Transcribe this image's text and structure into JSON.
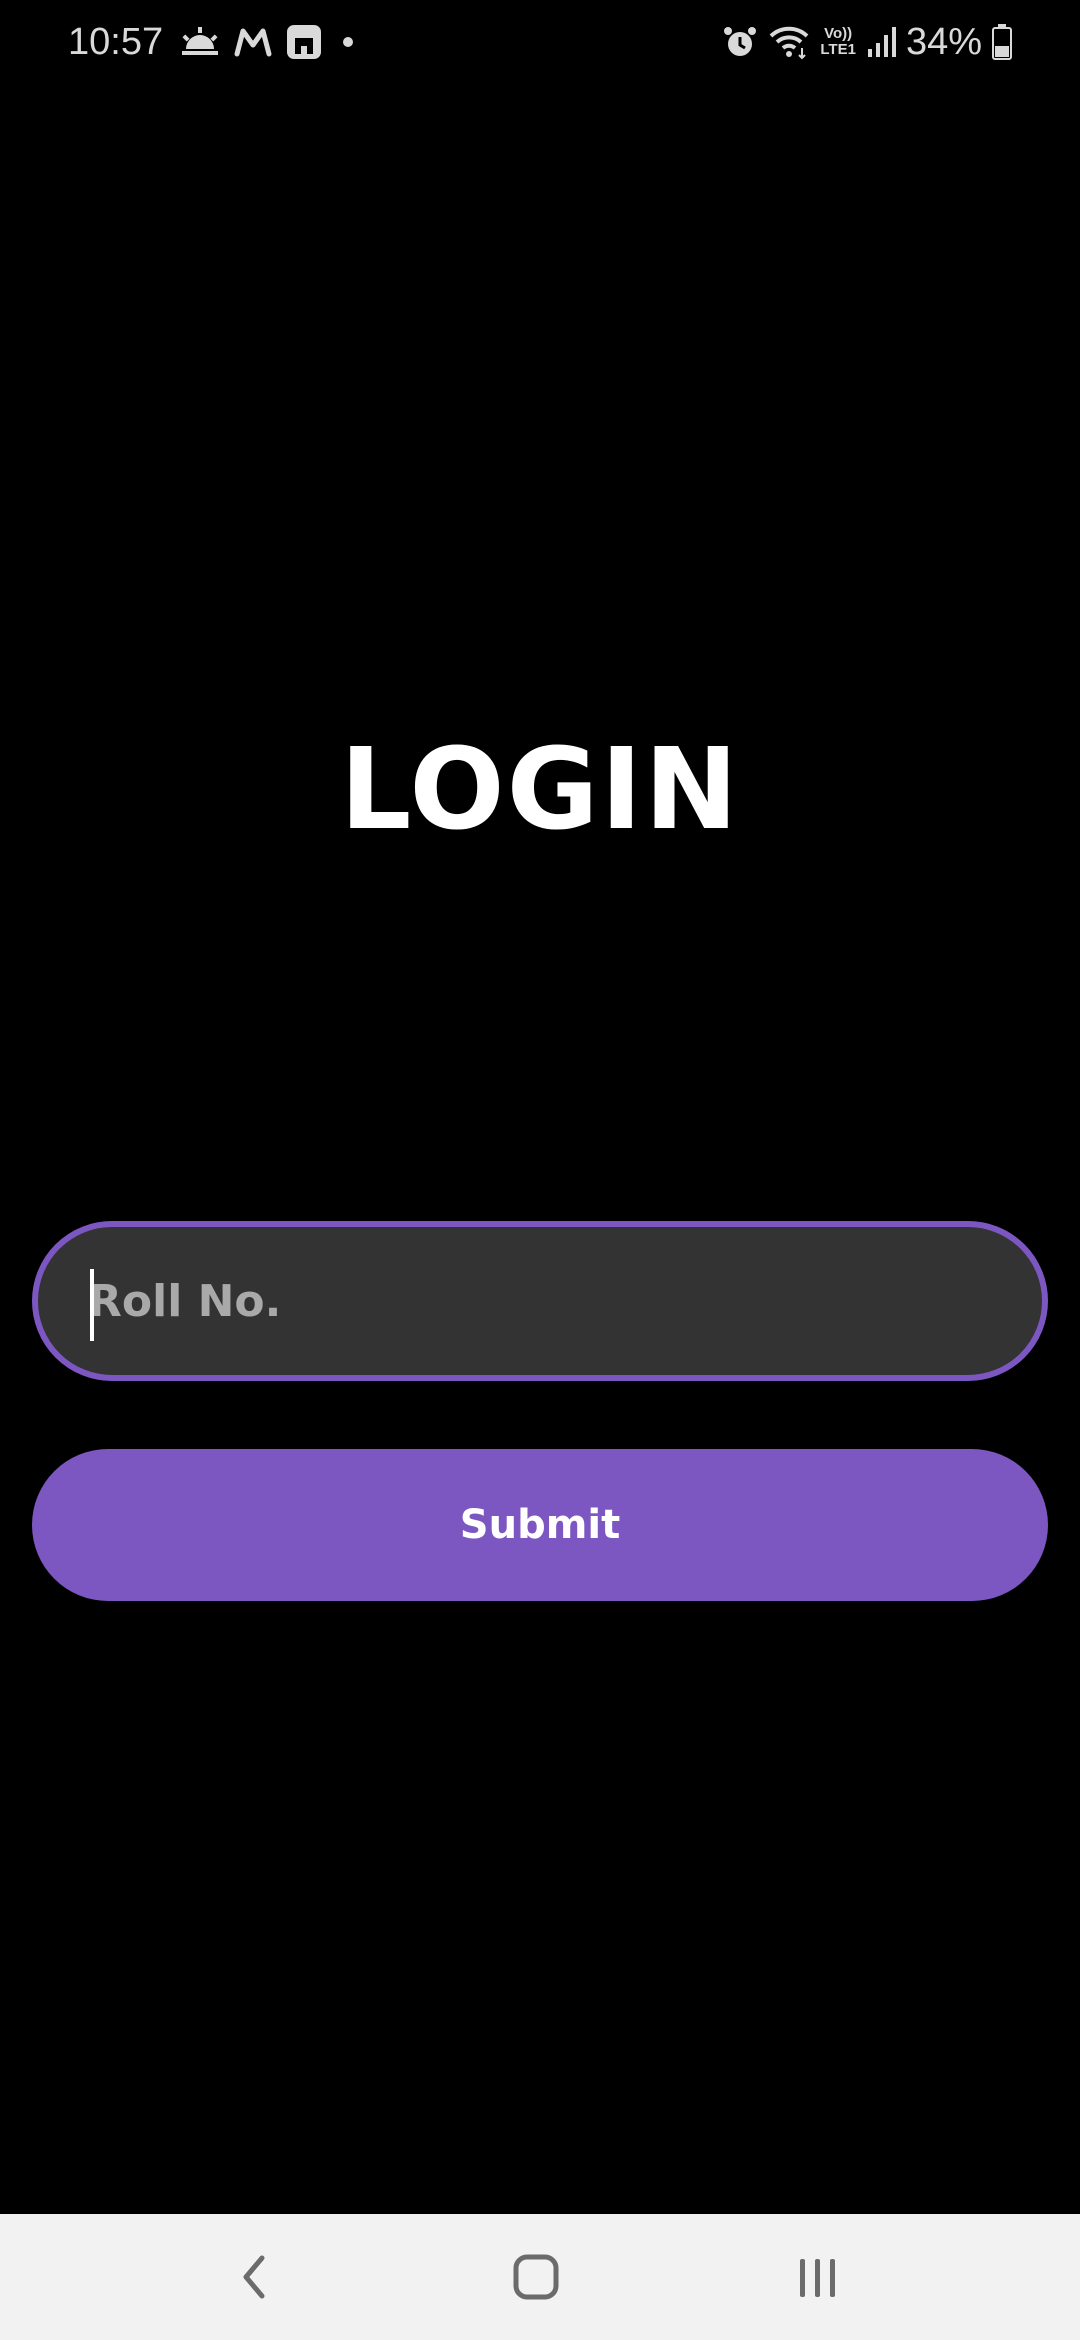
{
  "status_bar": {
    "time": "10:57",
    "battery": "34%",
    "left_icons": [
      "weather-sunrise-icon",
      "m-app-icon",
      "message-app-icon",
      "dot-icon"
    ],
    "right_icons": [
      "alarm-icon",
      "wifi-icon",
      "volte-lte-icon",
      "signal-icon",
      "battery-icon"
    ],
    "volte_label_top": "Vo))",
    "volte_label_bottom": "LTE1"
  },
  "login": {
    "title": "LOGIN",
    "roll_input": {
      "placeholder": "Roll No.",
      "value": ""
    },
    "submit_label": "Submit"
  },
  "colors": {
    "background": "#000000",
    "accent": "#7d57c1",
    "input_fill": "#333333",
    "nav_bar": "#f2f2f2"
  },
  "nav_bar": {
    "buttons": [
      "back-icon",
      "home-icon",
      "recents-icon"
    ]
  }
}
